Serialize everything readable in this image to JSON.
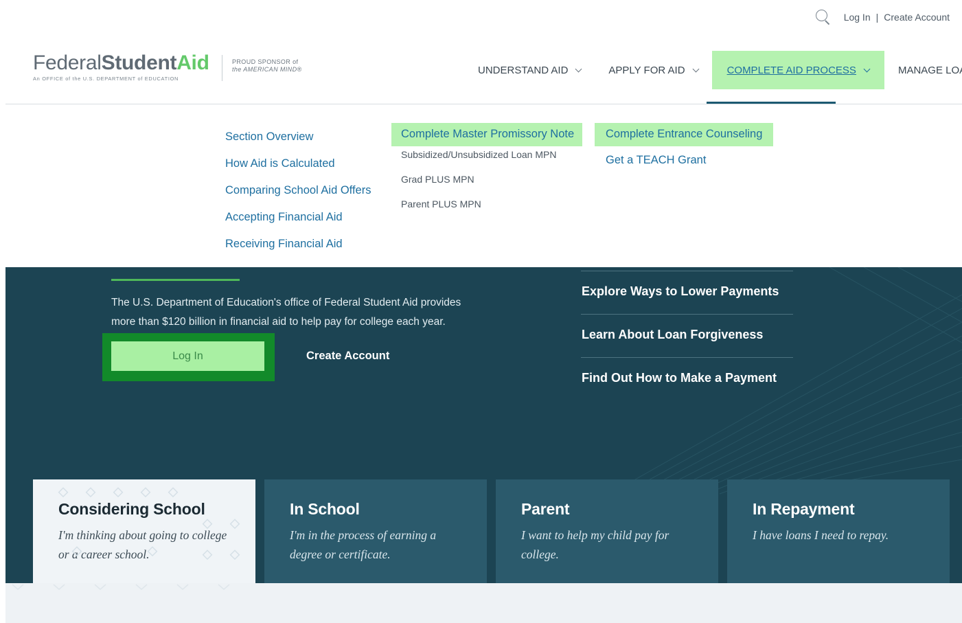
{
  "utility": {
    "login": "Log In",
    "separator": "|",
    "create_account": "Create Account"
  },
  "logo": {
    "federal": "Federal",
    "student": "Student",
    "aid": "Aid",
    "tagline": "An OFFICE of the U.S. DEPARTMENT of EDUCATION",
    "sponsor_line1": "PROUD SPONSOR of",
    "sponsor_line2": "the AMERICAN MIND®"
  },
  "nav": [
    {
      "label": "UNDERSTAND AID"
    },
    {
      "label": "APPLY FOR AID"
    },
    {
      "label": "COMPLETE AID PROCESS"
    },
    {
      "label": "MANAGE LOANS"
    }
  ],
  "menu": {
    "col1": [
      "Section Overview",
      "How Aid is Calculated",
      "Comparing School Aid Offers",
      "Accepting Financial Aid",
      "Receiving Financial Aid"
    ],
    "col2": {
      "head": "Complete Master Promissory Note",
      "subs": [
        "Subsidized/Unsubsidized Loan MPN",
        "Grad PLUS MPN",
        "Parent PLUS MPN"
      ]
    },
    "col3": {
      "head": "Complete Entrance Counseling",
      "items": [
        "Get a TEACH Grant"
      ]
    }
  },
  "hero": {
    "description": "The U.S. Department of Education's office of Federal Student Aid provides more than $120 billion in financial aid to help pay for college each year.",
    "login_button": "Log In",
    "create_account": "Create Account",
    "quick_links": [
      "Explore Ways to Lower Payments",
      "Learn About Loan Forgiveness",
      "Find Out How to Make a Payment"
    ]
  },
  "cards": [
    {
      "title": "Considering School",
      "desc": "I'm thinking about going to college or a career school."
    },
    {
      "title": "In School",
      "desc": "I'm in the process of earning a degree or certificate."
    },
    {
      "title": "Parent",
      "desc": "I want to help my child pay for college."
    },
    {
      "title": "In Repayment",
      "desc": "I have loans I need to repay."
    }
  ],
  "colors": {
    "brand_green": "#63c96a",
    "highlight_green": "#b5f2b0",
    "link_blue": "#1e6fa0",
    "hero_bg": "#1c4453",
    "card_bg": "#2b5a6c"
  }
}
